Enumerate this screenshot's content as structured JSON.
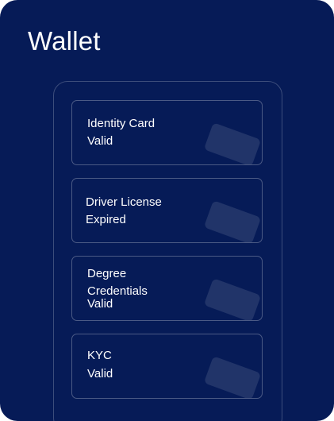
{
  "header": {
    "title": "Wallet"
  },
  "cards": [
    {
      "name": "Identity Card",
      "status": "Valid"
    },
    {
      "name": "Driver License",
      "status": "Expired"
    },
    {
      "name": "Degree\nCredentials",
      "status": "Valid"
    },
    {
      "name": "KYC",
      "status": "Valid"
    }
  ],
  "icons": {
    "card": "credential-card-icon"
  },
  "colors": {
    "background": "#061b57",
    "text": "#ffffff"
  }
}
